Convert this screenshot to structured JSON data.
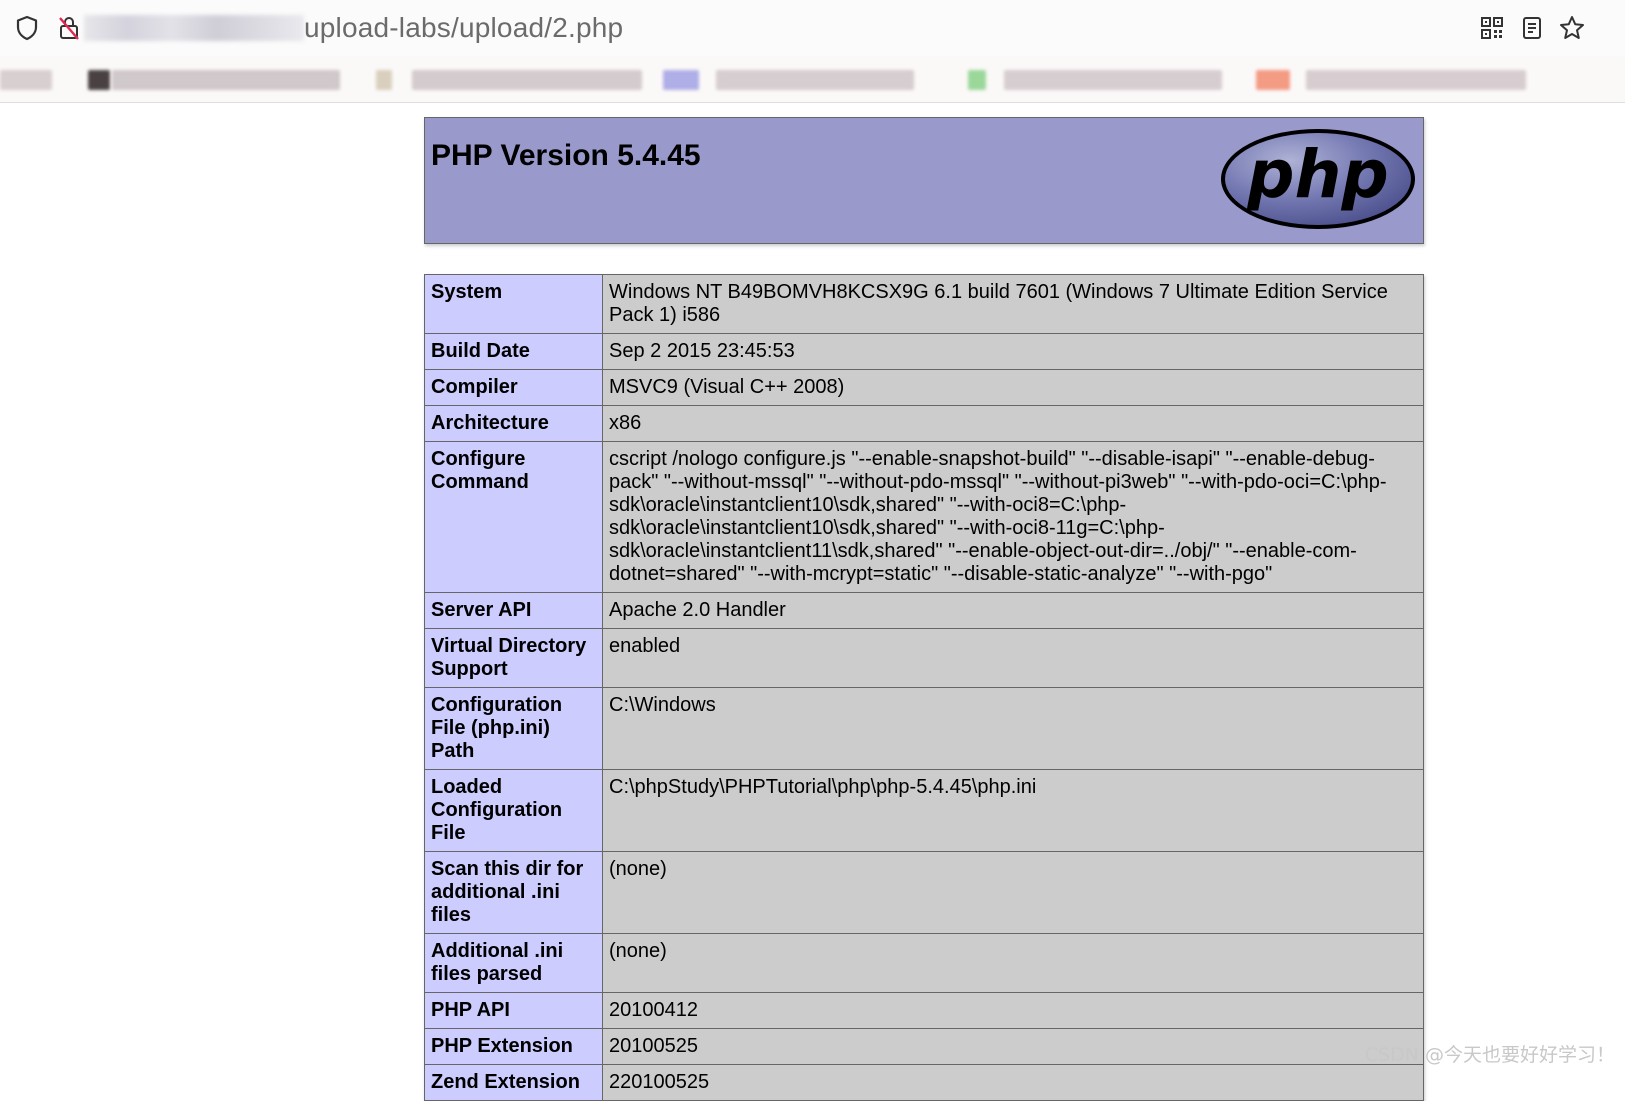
{
  "browser": {
    "url_path": "upload-labs/upload/2.php",
    "icons": [
      "shield-icon",
      "lock-slash-icon",
      "qr-code-icon",
      "reader-view-icon",
      "bookmark-star-icon"
    ]
  },
  "phpinfo": {
    "title": "PHP Version 5.4.45",
    "logo_text": "php",
    "rows": [
      {
        "key": "System",
        "value": "Windows NT B49BOMVH8KCSX9G 6.1 build 7601 (Windows 7 Ultimate Edition Service Pack 1) i586"
      },
      {
        "key": "Build Date",
        "value": "Sep 2 2015 23:45:53"
      },
      {
        "key": "Compiler",
        "value": "MSVC9 (Visual C++ 2008)"
      },
      {
        "key": "Architecture",
        "value": "x86"
      },
      {
        "key": "Configure Command",
        "value": "cscript /nologo configure.js \"--enable-snapshot-build\" \"--disable-isapi\" \"--enable-debug-pack\" \"--without-mssql\" \"--without-pdo-mssql\" \"--without-pi3web\" \"--with-pdo-oci=C:\\php-sdk\\oracle\\instantclient10\\sdk,shared\" \"--with-oci8=C:\\php-sdk\\oracle\\instantclient10\\sdk,shared\" \"--with-oci8-11g=C:\\php-sdk\\oracle\\instantclient11\\sdk,shared\" \"--enable-object-out-dir=../obj/\" \"--enable-com-dotnet=shared\" \"--with-mcrypt=static\" \"--disable-static-analyze\" \"--with-pgo\""
      },
      {
        "key": "Server API",
        "value": "Apache 2.0 Handler"
      },
      {
        "key": "Virtual Directory Support",
        "value": "enabled"
      },
      {
        "key": "Configuration File (php.ini) Path",
        "value": "C:\\Windows"
      },
      {
        "key": "Loaded Configuration File",
        "value": "C:\\phpStudy\\PHPTutorial\\php\\php-5.4.45\\php.ini"
      },
      {
        "key": "Scan this dir for additional .ini files",
        "value": "(none)"
      },
      {
        "key": "Additional .ini files parsed",
        "value": "(none)"
      },
      {
        "key": "PHP API",
        "value": "20100412"
      },
      {
        "key": "PHP Extension",
        "value": "20100525"
      },
      {
        "key": "Zend Extension",
        "value": "220100525"
      }
    ]
  },
  "watermark": "CSDN @今天也要好好学习！"
}
